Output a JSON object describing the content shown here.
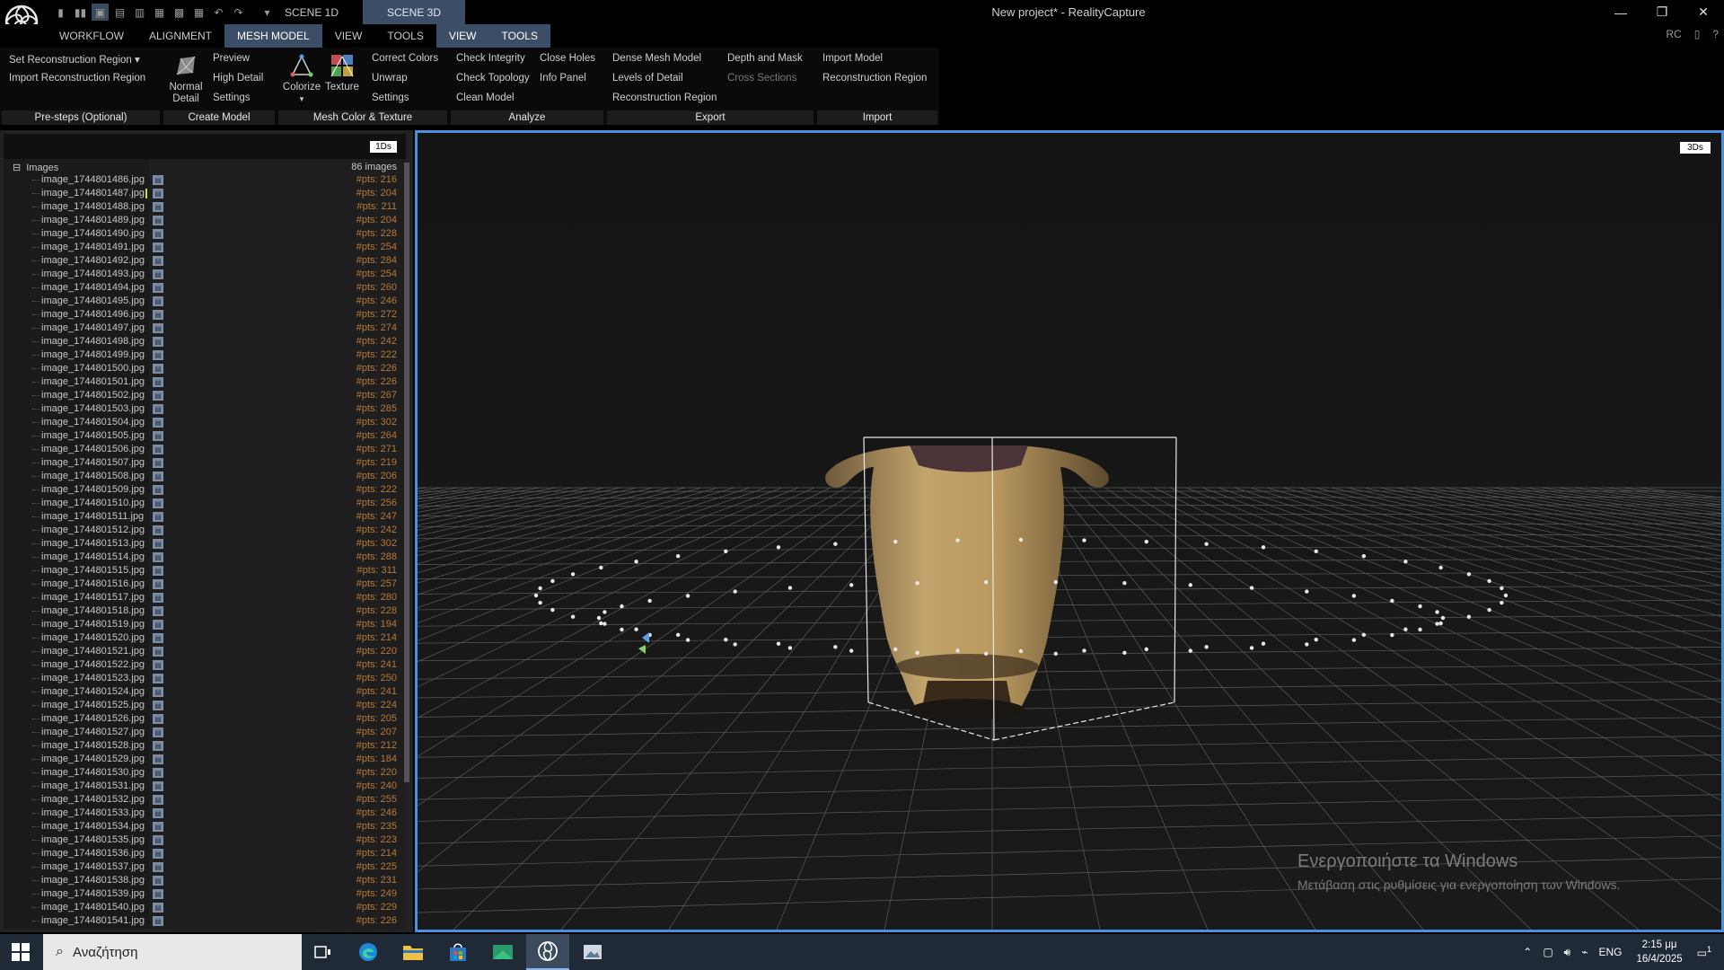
{
  "window": {
    "title": "New project* - RealityCapture",
    "scene_tabs": [
      "SCENE 1D",
      "SCENE 3D"
    ],
    "controls": [
      "—",
      "❐",
      "✕"
    ]
  },
  "menu": {
    "items": [
      "WORKFLOW",
      "ALIGNMENT",
      "MESH MODEL",
      "VIEW",
      "TOOLS",
      "VIEW",
      "TOOLS"
    ],
    "right": [
      "RC"
    ]
  },
  "ribbon": {
    "pre_steps": {
      "label": "Pre-steps (Optional)",
      "set_region": "Set Reconstruction Region",
      "import_region": "Import Reconstruction Region"
    },
    "create_model": {
      "label": "Create Model",
      "normal_detail": "Normal Detail",
      "preview": "Preview",
      "high_detail": "High Detail",
      "settings": "Settings"
    },
    "mesh_color": {
      "label": "Mesh Color & Texture",
      "colorize": "Colorize",
      "texture": "Texture",
      "correct_colors": "Correct Colors",
      "unwrap": "Unwrap",
      "settings": "Settings"
    },
    "analyze": {
      "label": "Analyze",
      "check_integrity": "Check Integrity",
      "close_holes": "Close Holes",
      "check_topology": "Check Topology",
      "info_panel": "Info Panel",
      "clean_model": "Clean Model"
    },
    "export": {
      "label": "Export",
      "dense_mesh": "Dense Mesh Model",
      "depth_mask": "Depth and Mask",
      "levels_detail": "Levels of Detail",
      "cross_sections": "Cross Sections",
      "recon_region": "Reconstruction Region"
    },
    "import": {
      "label": "Import",
      "import_model": "Import Model",
      "recon_region": "Reconstruction Region"
    }
  },
  "left_panel": {
    "badge": "1Ds",
    "tree_root": "Images",
    "tree_toggle": "⊟",
    "count": "86 images",
    "images": [
      {
        "name": "image_1744801486.jpg",
        "pts": "#pts: 216"
      },
      {
        "name": "image_1744801487.jpg",
        "pts": "#pts: 204"
      },
      {
        "name": "image_1744801488.jpg",
        "pts": "#pts: 211"
      },
      {
        "name": "image_1744801489.jpg",
        "pts": "#pts: 204"
      },
      {
        "name": "image_1744801490.jpg",
        "pts": "#pts: 228"
      },
      {
        "name": "image_1744801491.jpg",
        "pts": "#pts: 254"
      },
      {
        "name": "image_1744801492.jpg",
        "pts": "#pts: 284"
      },
      {
        "name": "image_1744801493.jpg",
        "pts": "#pts: 254"
      },
      {
        "name": "image_1744801494.jpg",
        "pts": "#pts: 260"
      },
      {
        "name": "image_1744801495.jpg",
        "pts": "#pts: 246"
      },
      {
        "name": "image_1744801496.jpg",
        "pts": "#pts: 272"
      },
      {
        "name": "image_1744801497.jpg",
        "pts": "#pts: 274"
      },
      {
        "name": "image_1744801498.jpg",
        "pts": "#pts: 242"
      },
      {
        "name": "image_1744801499.jpg",
        "pts": "#pts: 222"
      },
      {
        "name": "image_1744801500.jpg",
        "pts": "#pts: 226"
      },
      {
        "name": "image_1744801501.jpg",
        "pts": "#pts: 226"
      },
      {
        "name": "image_1744801502.jpg",
        "pts": "#pts: 267"
      },
      {
        "name": "image_1744801503.jpg",
        "pts": "#pts: 285"
      },
      {
        "name": "image_1744801504.jpg",
        "pts": "#pts: 302"
      },
      {
        "name": "image_1744801505.jpg",
        "pts": "#pts: 264"
      },
      {
        "name": "image_1744801506.jpg",
        "pts": "#pts: 271"
      },
      {
        "name": "image_1744801507.jpg",
        "pts": "#pts: 219"
      },
      {
        "name": "image_1744801508.jpg",
        "pts": "#pts: 206"
      },
      {
        "name": "image_1744801509.jpg",
        "pts": "#pts: 222"
      },
      {
        "name": "image_1744801510.jpg",
        "pts": "#pts: 256"
      },
      {
        "name": "image_1744801511.jpg",
        "pts": "#pts: 247"
      },
      {
        "name": "image_1744801512.jpg",
        "pts": "#pts: 242"
      },
      {
        "name": "image_1744801513.jpg",
        "pts": "#pts: 302"
      },
      {
        "name": "image_1744801514.jpg",
        "pts": "#pts: 288"
      },
      {
        "name": "image_1744801515.jpg",
        "pts": "#pts: 311"
      },
      {
        "name": "image_1744801516.jpg",
        "pts": "#pts: 257"
      },
      {
        "name": "image_1744801517.jpg",
        "pts": "#pts: 280"
      },
      {
        "name": "image_1744801518.jpg",
        "pts": "#pts: 228"
      },
      {
        "name": "image_1744801519.jpg",
        "pts": "#pts: 194"
      },
      {
        "name": "image_1744801520.jpg",
        "pts": "#pts: 214"
      },
      {
        "name": "image_1744801521.jpg",
        "pts": "#pts: 220"
      },
      {
        "name": "image_1744801522.jpg",
        "pts": "#pts: 241"
      },
      {
        "name": "image_1744801523.jpg",
        "pts": "#pts: 250"
      },
      {
        "name": "image_1744801524.jpg",
        "pts": "#pts: 241"
      },
      {
        "name": "image_1744801525.jpg",
        "pts": "#pts: 224"
      },
      {
        "name": "image_1744801526.jpg",
        "pts": "#pts: 205"
      },
      {
        "name": "image_1744801527.jpg",
        "pts": "#pts: 207"
      },
      {
        "name": "image_1744801528.jpg",
        "pts": "#pts: 212"
      },
      {
        "name": "image_1744801529.jpg",
        "pts": "#pts: 184"
      },
      {
        "name": "image_1744801530.jpg",
        "pts": "#pts: 220"
      },
      {
        "name": "image_1744801531.jpg",
        "pts": "#pts: 240"
      },
      {
        "name": "image_1744801532.jpg",
        "pts": "#pts: 255"
      },
      {
        "name": "image_1744801533.jpg",
        "pts": "#pts: 246"
      },
      {
        "name": "image_1744801534.jpg",
        "pts": "#pts: 235"
      },
      {
        "name": "image_1744801535.jpg",
        "pts": "#pts: 223"
      },
      {
        "name": "image_1744801536.jpg",
        "pts": "#pts: 214"
      },
      {
        "name": "image_1744801537.jpg",
        "pts": "#pts: 225"
      },
      {
        "name": "image_1744801538.jpg",
        "pts": "#pts: 231"
      },
      {
        "name": "image_1744801539.jpg",
        "pts": "#pts: 249"
      },
      {
        "name": "image_1744801540.jpg",
        "pts": "#pts: 229"
      },
      {
        "name": "image_1744801541.jpg",
        "pts": "#pts: 226"
      }
    ]
  },
  "viewport": {
    "badge": "3Ds",
    "watermark_title": "Ενεργοποιήστε τα Windows",
    "watermark_sub": "Μετάβαση στις ρυθμίσεις για ενεργοποίηση των Windows."
  },
  "taskbar": {
    "search_placeholder": "Αναζήτηση",
    "language": "ENG",
    "time": "2:15 μμ",
    "date": "16/4/2025",
    "notification_count": "1"
  },
  "colors": {
    "accent": "#4a90e2",
    "active_tab": "#3c4e66",
    "pts_text": "#b8793a"
  }
}
